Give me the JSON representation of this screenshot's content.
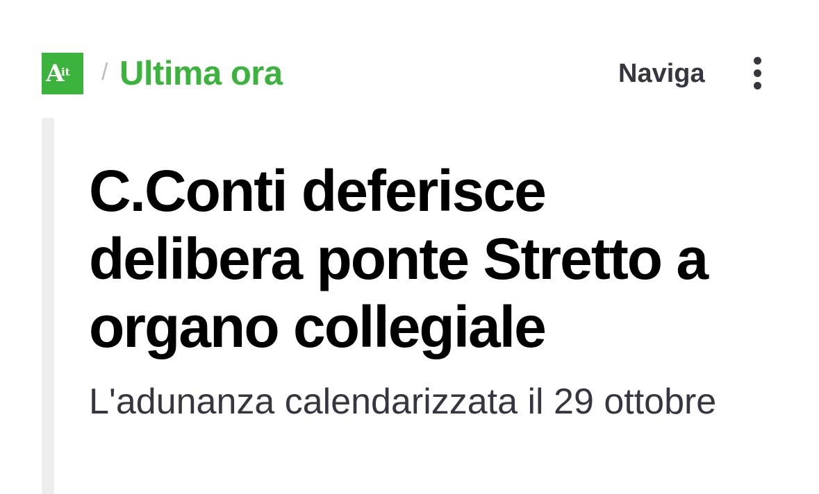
{
  "header": {
    "logo_text_main": "A",
    "logo_text_suffix": "it",
    "separator": "/",
    "section": "Ultima ora",
    "nav_label": "Naviga"
  },
  "article": {
    "headline": "C.Conti deferisce delibera ponte Stretto a organo collegiale",
    "subheadline": "L'adunanza calendarizzata il 29 ottobre"
  },
  "colors": {
    "brand_green": "#3cb33c",
    "text_dark": "#35363f",
    "headline": "#000000",
    "rule": "#eeeeee"
  },
  "icons": {
    "menu": "more-vertical-icon"
  }
}
